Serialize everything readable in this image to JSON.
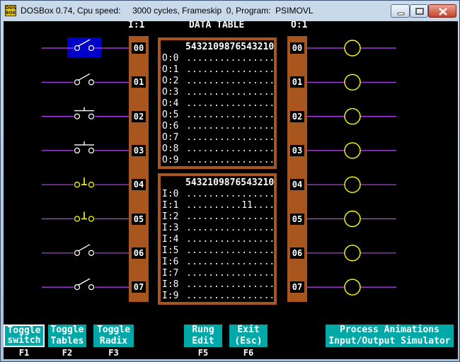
{
  "window": {
    "title": "DOSBox 0.74, Cpu speed:     3000 cycles, Frameskip  0, Program:  PSIMOVL",
    "icon_text": "DOS BOX",
    "buttons": [
      "minimize",
      "maximize",
      "close"
    ]
  },
  "header": {
    "inputs_label": "I:1",
    "table_label": "DATA TABLE",
    "outputs_label": "O:1"
  },
  "inputs": [
    {
      "addr": "00",
      "symbol": "normally-open-switch",
      "highlighted": true,
      "color": "#ffffff"
    },
    {
      "addr": "01",
      "symbol": "normally-open-switch",
      "highlighted": false,
      "color": "#ffffff"
    },
    {
      "addr": "02",
      "symbol": "pushbutton-open",
      "highlighted": false,
      "color": "#ffffff"
    },
    {
      "addr": "03",
      "symbol": "pushbutton-open",
      "highlighted": false,
      "color": "#ffffff"
    },
    {
      "addr": "04",
      "symbol": "pushbutton-closed",
      "highlighted": false,
      "color": "#ffff00"
    },
    {
      "addr": "05",
      "symbol": "pushbutton-closed",
      "highlighted": false,
      "color": "#ffff00"
    },
    {
      "addr": "06",
      "symbol": "normally-open-switch",
      "highlighted": false,
      "color": "#ffffff"
    },
    {
      "addr": "07",
      "symbol": "normally-open-switch",
      "highlighted": false,
      "color": "#ffffff"
    }
  ],
  "outputs": [
    {
      "addr": "00",
      "symbol": "lamp-circle",
      "color": "#ffff00"
    },
    {
      "addr": "01",
      "symbol": "lamp-circle",
      "color": "#ffff00"
    },
    {
      "addr": "02",
      "symbol": "lamp-circle",
      "color": "#ffff00"
    },
    {
      "addr": "03",
      "symbol": "lamp-circle",
      "color": "#ffff00"
    },
    {
      "addr": "04",
      "symbol": "lamp-circle",
      "color": "#ffff00"
    },
    {
      "addr": "05",
      "symbol": "lamp-circle",
      "color": "#ffff00"
    },
    {
      "addr": "06",
      "symbol": "lamp-circle",
      "color": "#ffff00"
    },
    {
      "addr": "07",
      "symbol": "lamp-circle",
      "color": "#ffff00"
    }
  ],
  "output_table": {
    "bit_header": "5432109876543210",
    "rows": [
      {
        "label": "O:0",
        "bits": "................"
      },
      {
        "label": "O:1",
        "bits": "................"
      },
      {
        "label": "O:2",
        "bits": "................"
      },
      {
        "label": "O:3",
        "bits": "................"
      },
      {
        "label": "O:4",
        "bits": "................"
      },
      {
        "label": "O:5",
        "bits": "................"
      },
      {
        "label": "O:6",
        "bits": "................"
      },
      {
        "label": "O:7",
        "bits": "................"
      },
      {
        "label": "O:8",
        "bits": "................"
      },
      {
        "label": "O:9",
        "bits": "................"
      }
    ]
  },
  "input_table": {
    "bit_header": "5432109876543210",
    "rows": [
      {
        "label": "I:0",
        "bits": "................"
      },
      {
        "label": "I:1",
        "bits": "..........11...."
      },
      {
        "label": "I:2",
        "bits": "................"
      },
      {
        "label": "I:3",
        "bits": "................"
      },
      {
        "label": "I:4",
        "bits": "................"
      },
      {
        "label": "I:5",
        "bits": "................"
      },
      {
        "label": "I:6",
        "bits": "................"
      },
      {
        "label": "I:7",
        "bits": "................"
      },
      {
        "label": "I:8",
        "bits": "................"
      },
      {
        "label": "I:9",
        "bits": "................"
      }
    ]
  },
  "function_keys": [
    {
      "label": "Toggle\nswitch",
      "key": "F1",
      "selected": true
    },
    {
      "label": "Toggle\nTables",
      "key": "F2",
      "selected": false
    },
    {
      "label": "Toggle\nRadix",
      "key": "F3",
      "selected": false
    },
    {
      "label": "Rung\nEdit",
      "key": "F5",
      "selected": false
    },
    {
      "label": "Exit\n(Esc)",
      "key": "F6",
      "selected": false
    },
    {
      "label": "Process Animations\nInput/Output Simulator",
      "key": "",
      "selected": false
    }
  ],
  "colors": {
    "background": "#000000",
    "rail": "#a8561e",
    "wire": "#c040ff",
    "key_bg": "#00a8a8",
    "highlight": "#0000c8"
  }
}
